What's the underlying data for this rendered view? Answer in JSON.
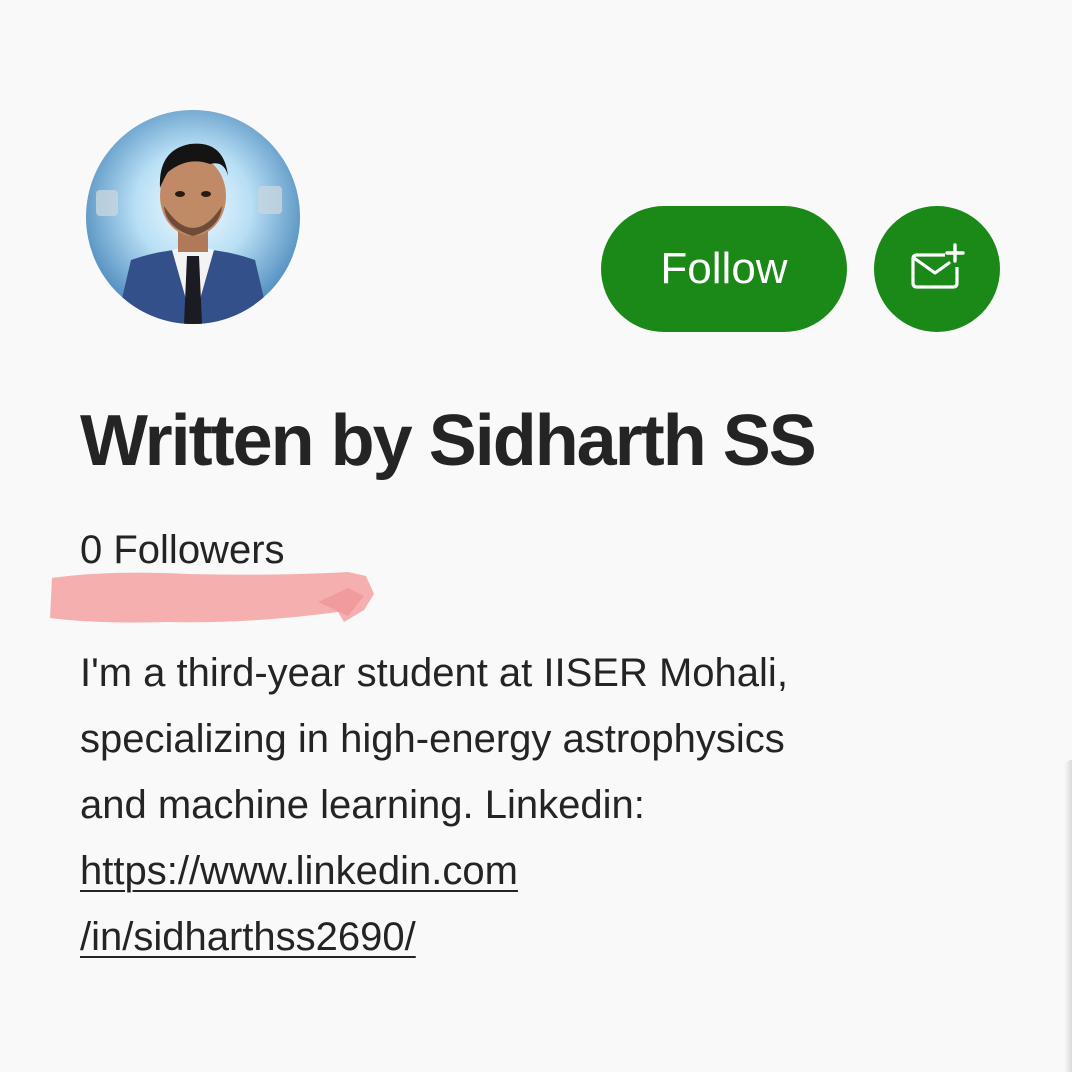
{
  "author": {
    "avatar_alt": "profile photo",
    "heading": "Written by Sidharth SS",
    "followers": "0 Followers",
    "bio_lines": [
      "I'm a third-year student at IISER Mohali,",
      "specializing in high-energy astrophysics",
      "and machine learning. Linkedin:"
    ],
    "link_lines": [
      "https://www.linkedin.com",
      "/in/sidharthss2690/"
    ]
  },
  "actions": {
    "follow_label": "Follow",
    "subscribe_icon": "mail-plus-icon"
  },
  "colors": {
    "accent": "#1a8917",
    "background": "#f9f9f9",
    "text": "#242424",
    "highlight": "#f4a6a6"
  }
}
